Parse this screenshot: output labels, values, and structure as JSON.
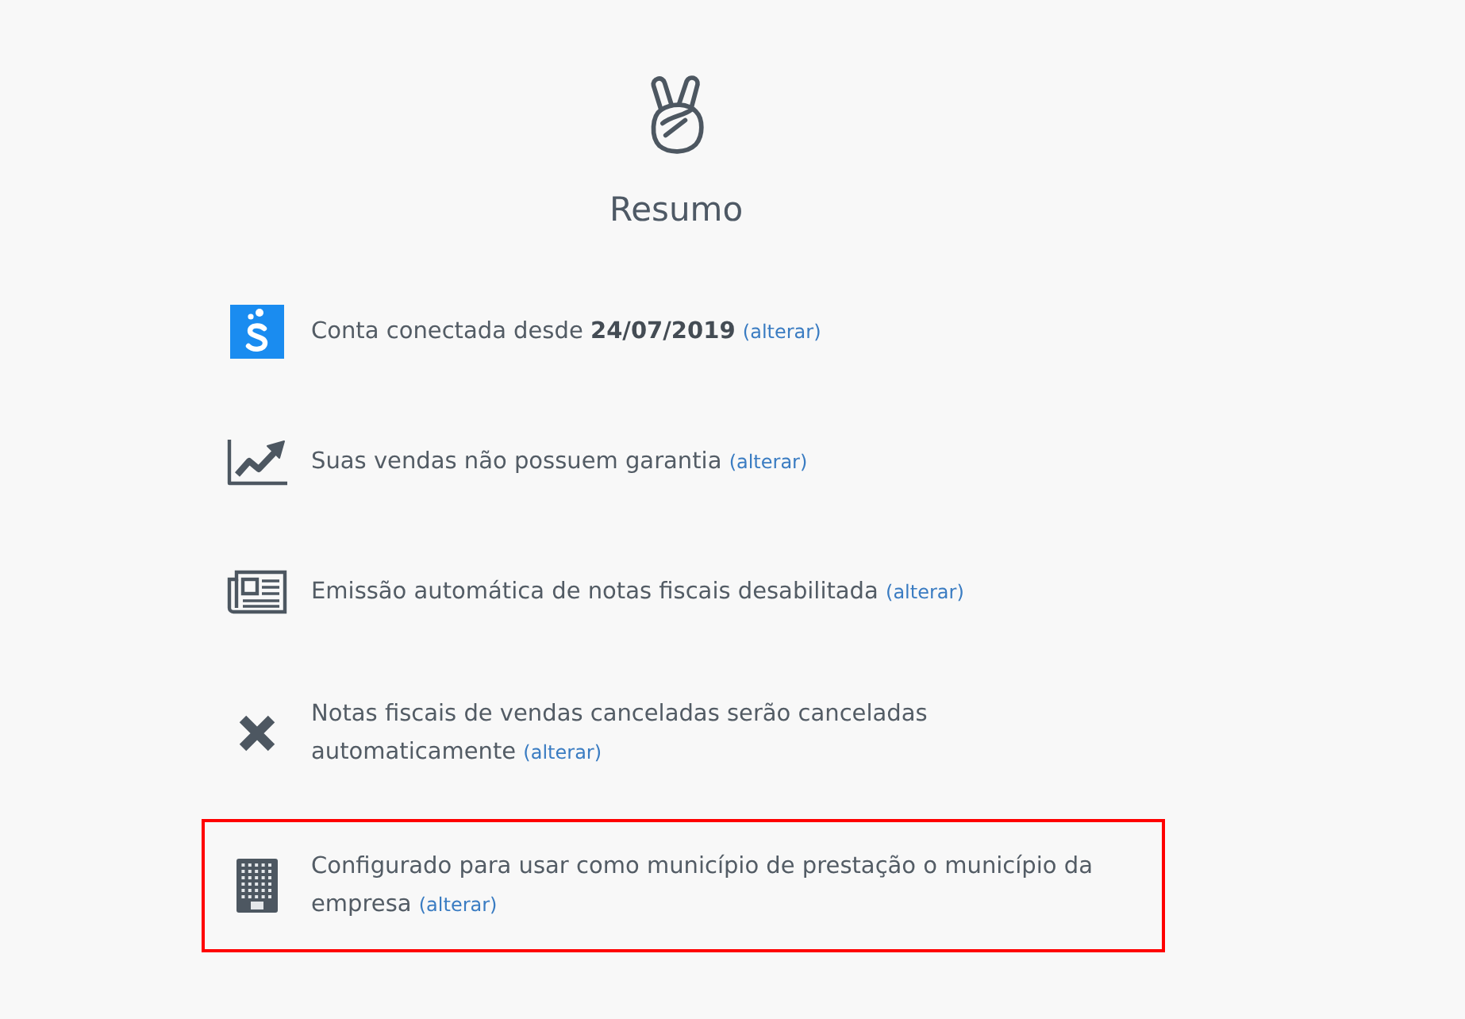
{
  "header": {
    "title": "Resumo"
  },
  "items": [
    {
      "kind": "account",
      "text": "Conta conectada desde **24/07/2019**",
      "link": "(alterar)",
      "highlighted": false
    },
    {
      "kind": "chart",
      "text": "Suas vendas não possuem garantia",
      "link": "(alterar)",
      "highlighted": false
    },
    {
      "kind": "newspaper",
      "text": "Emissão automática de notas fiscais desabilitada",
      "link": "(alterar)",
      "highlighted": false
    },
    {
      "kind": "cross",
      "text": "Notas fiscais de vendas canceladas serão canceladas automaticamente",
      "link": "(alterar)",
      "highlighted": false
    },
    {
      "kind": "building",
      "text": "Configurado para usar como município de prestação o município da empresa",
      "link": "(alterar)",
      "highlighted": true
    }
  ]
}
